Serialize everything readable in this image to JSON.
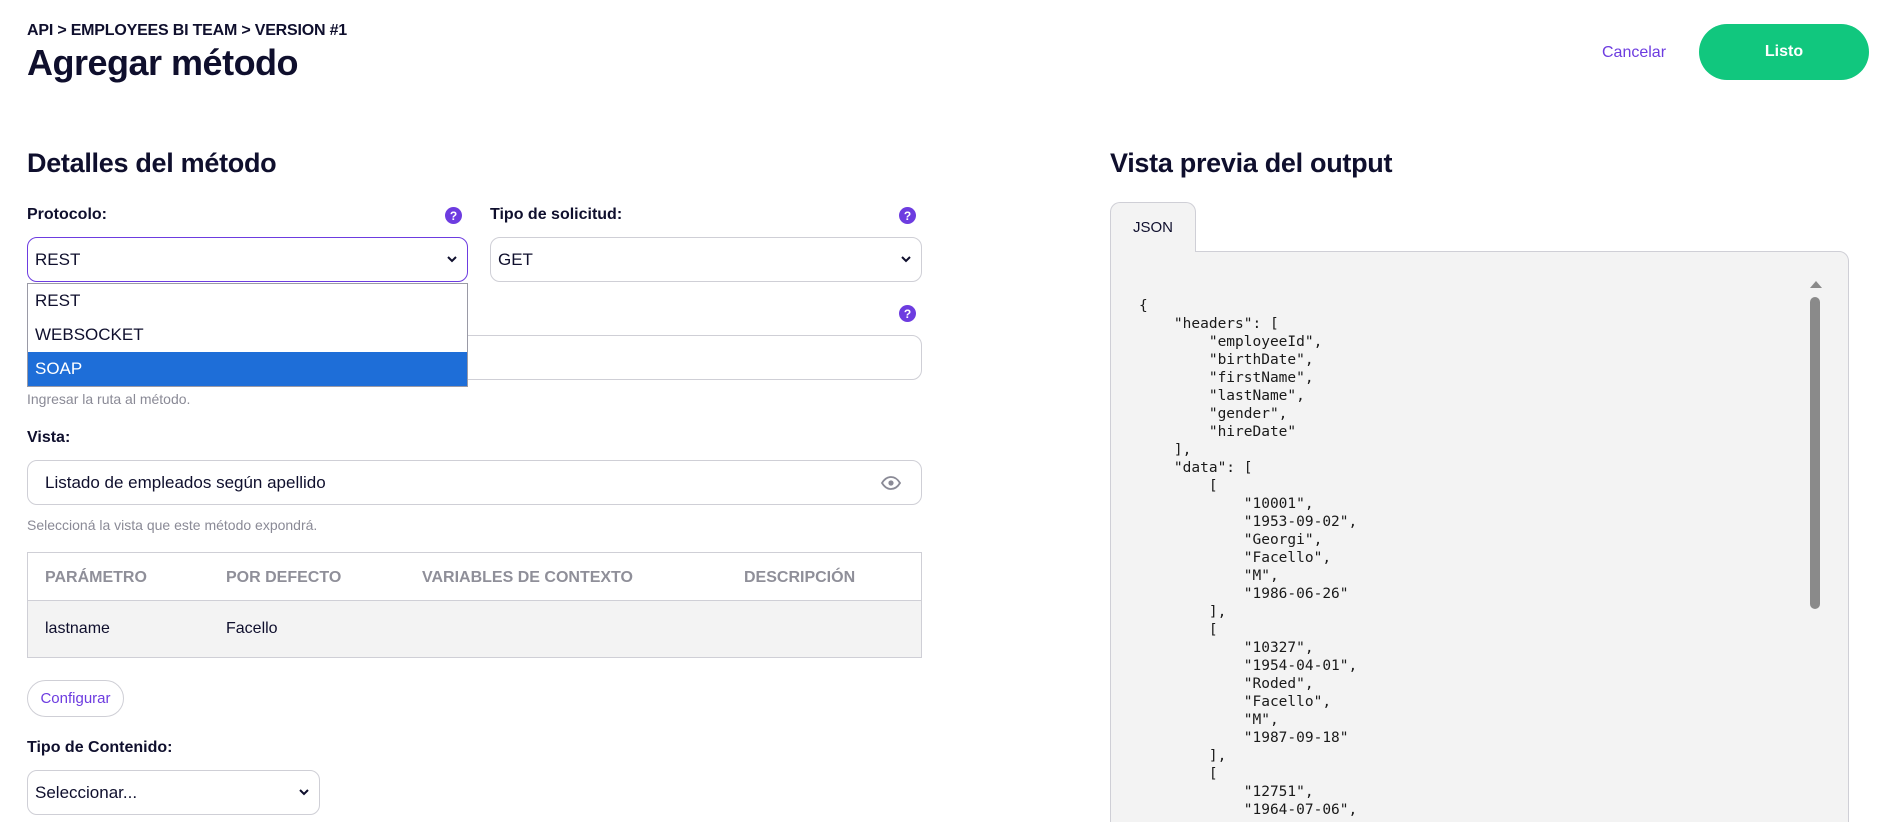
{
  "header": {
    "breadcrumb": "API > EMPLOYEES BI TEAM > VERSION #1",
    "title": "Agregar método",
    "cancel_label": "Cancelar",
    "done_label": "Listo"
  },
  "details": {
    "section_title": "Detalles del método",
    "protocol": {
      "label": "Protocolo:",
      "value": "REST",
      "help": "?",
      "options": [
        "REST",
        "WEBSOCKET",
        "SOAP"
      ],
      "highlighted": "SOAP"
    },
    "request_type": {
      "label": "Tipo de solicitud:",
      "value": "GET",
      "help": "?"
    },
    "path": {
      "help": "?",
      "hint": "Ingresar la ruta al método."
    },
    "view": {
      "label": "Vista:",
      "value": "Listado de empleados según apellido",
      "hint": "Seleccioná la vista que este método expondrá.",
      "icon": "eye-icon"
    },
    "params_table": {
      "headers": [
        "PARÁMETRO",
        "POR DEFECTO",
        "VARIABLES DE CONTEXTO",
        "DESCRIPCIÓN"
      ],
      "rows": [
        {
          "param": "lastname",
          "default": "Facello",
          "context": "",
          "description": ""
        }
      ]
    },
    "configure_label": "Configurar",
    "content_type": {
      "label": "Tipo de Contenido:",
      "value": "Seleccionar..."
    }
  },
  "preview": {
    "section_title": "Vista previa del output",
    "tab_label": "JSON",
    "json_text": "{\n    \"headers\": [\n        \"employeeId\",\n        \"birthDate\",\n        \"firstName\",\n        \"lastName\",\n        \"gender\",\n        \"hireDate\"\n    ],\n    \"data\": [\n        [\n            \"10001\",\n            \"1953-09-02\",\n            \"Georgi\",\n            \"Facello\",\n            \"M\",\n            \"1986-06-26\"\n        ],\n        [\n            \"10327\",\n            \"1954-04-01\",\n            \"Roded\",\n            \"Facello\",\n            \"M\",\n            \"1987-09-18\"\n        ],\n        [\n            \"12751\",\n            \"1964-07-06\","
  },
  "colors": {
    "accent": "#6d3ce0",
    "primary_button": "#11c77e",
    "selected_option": "#1e6ed8"
  }
}
